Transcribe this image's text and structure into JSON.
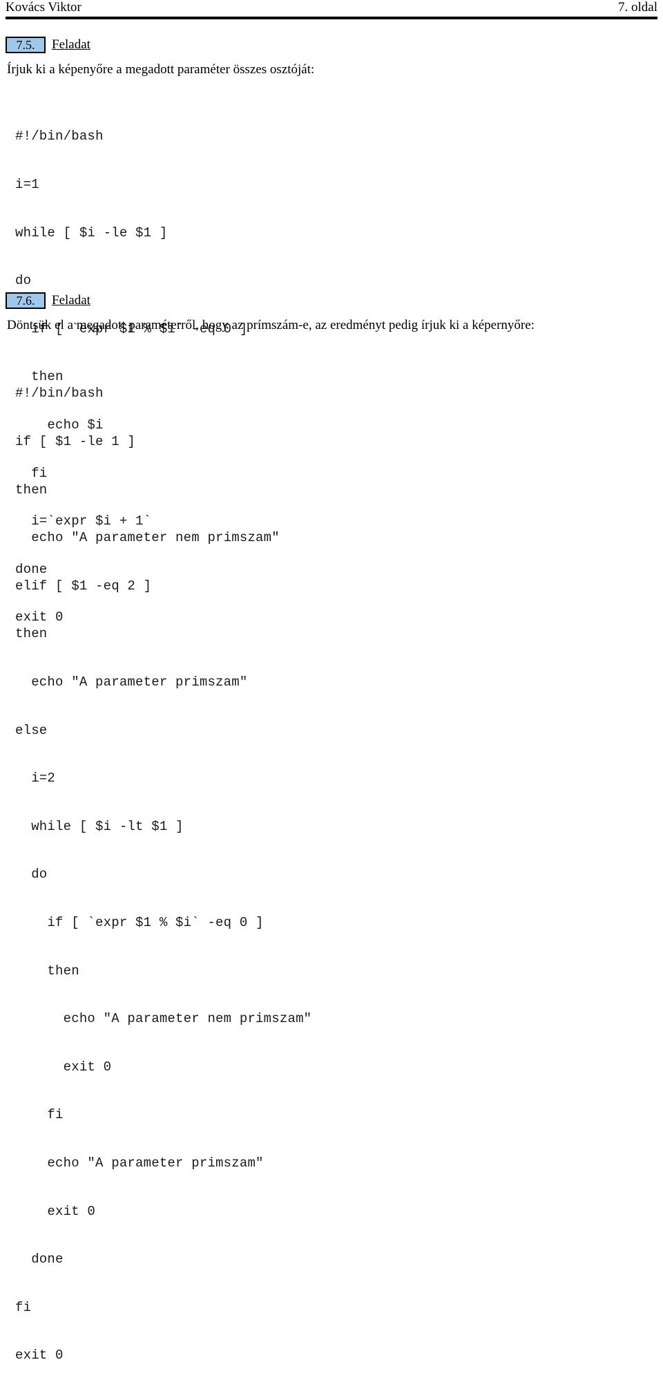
{
  "header": {
    "author": "Kovács Viktor",
    "page_label": "7. oldal"
  },
  "tasks": [
    {
      "number": "7.5.",
      "title": "Feladat",
      "description": "Írjuk ki a képenyőre a megadott paraméter összes osztóját:",
      "code": [
        "#!/bin/bash",
        "i=1",
        "while [ $i -le $1 ]",
        "do",
        "  if [ `expr $1 % $i` -eq 0 ]",
        "  then",
        "    echo $i",
        "  fi",
        "  i=`expr $i + 1`",
        "done",
        "exit 0"
      ]
    },
    {
      "number": "7.6.",
      "title": "Feladat",
      "description": "Döntsük el a megadott paraméterről, hogy az prímszám-e, az eredményt pedig írjuk ki a képernyőre:",
      "code": [
        "#!/bin/bash",
        "if [ $1 -le 1 ]",
        "then",
        "  echo \"A parameter nem primszam\"",
        "elif [ $1 -eq 2 ]",
        "then",
        "  echo \"A parameter primszam\"",
        "else",
        "  i=2",
        "  while [ $i -lt $1 ]",
        "  do",
        "    if [ `expr $1 % $i` -eq 0 ]",
        "    then",
        "      echo \"A parameter nem primszam\"",
        "      exit 0",
        "    fi",
        "    echo \"A parameter primszam\"",
        "    exit 0",
        "  done",
        "fi",
        "exit 0"
      ]
    }
  ],
  "colors": {
    "task_number_background": "#9ec8ec",
    "task_number_border": "#000000",
    "text": "#000000",
    "code_text": "#1a1a1a",
    "page_background": "#ffffff"
  }
}
